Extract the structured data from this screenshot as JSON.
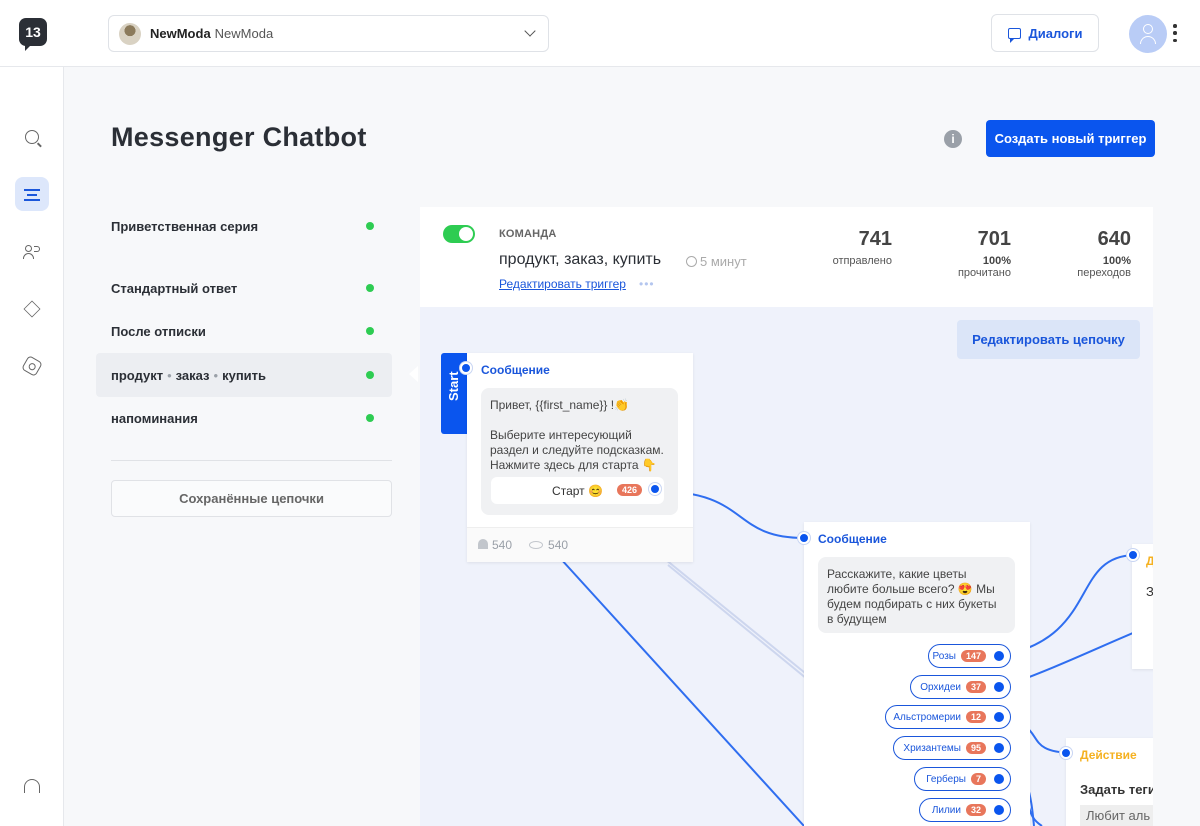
{
  "topbar": {
    "logo": "13",
    "account": {
      "name": "NewModa",
      "sub": "NewModa"
    },
    "dialogs_label": "Диалоги"
  },
  "rail": {
    "items": [
      {
        "icon": "search-icon"
      },
      {
        "icon": "flow-icon",
        "active": true
      },
      {
        "icon": "users-icon"
      },
      {
        "icon": "layers-icon"
      },
      {
        "icon": "settings-icon"
      },
      {
        "icon": "support-icon"
      }
    ]
  },
  "page": {
    "title": "Messenger Chatbot",
    "create_label": "Создать новый триггер"
  },
  "triggers": [
    {
      "label": "Приветственная серия"
    },
    {
      "label": "Стандартный ответ"
    },
    {
      "label": "После отписки"
    },
    {
      "parts": [
        "продукт",
        "заказ",
        "купить"
      ],
      "sep": "•",
      "active": true
    },
    {
      "label": "напоминания"
    }
  ],
  "saved_label": "Сохранённые цепочки",
  "trigger_header": {
    "type_label": "КОМАНДА",
    "keywords": "продукт, заказ, купить",
    "delay": "5 минут",
    "edit_label": "Редактировать триггер",
    "more": "•••",
    "stats": [
      {
        "value": "741",
        "pct": "",
        "label": "отправлено"
      },
      {
        "value": "701",
        "pct": "100%",
        "label": "прочитано"
      },
      {
        "value": "640",
        "pct": "100%",
        "label": "переходов"
      }
    ]
  },
  "canvas": {
    "edit_chain_label": "Редактировать цепочку",
    "start_label": "Start",
    "card1": {
      "title": "Сообщение",
      "line1": "Привет,  {{first_name}} !👏",
      "line2": "Выберите интересующий раздел и следуйте подсказкам. Нажмите здесь для старта 👇",
      "button_label": "Старт 😊",
      "button_count": "426",
      "users": "540",
      "views": "540"
    },
    "card2": {
      "title": "Сообщение",
      "text": "Расскажите, какие цветы любите больше всего? 😍 Мы будем подбирать с них букеты в будущем",
      "buttons": [
        {
          "label": "Розы",
          "count": "147"
        },
        {
          "label": "Орхидеи",
          "count": "37"
        },
        {
          "label": "Альстромерии",
          "count": "12"
        },
        {
          "label": "Хризантемы",
          "count": "95"
        },
        {
          "label": "Герберы",
          "count": "7"
        },
        {
          "label": "Лилии",
          "count": "32"
        }
      ]
    },
    "card3": {
      "title": "Д",
      "line": "З"
    },
    "card4": {
      "title": "Действие",
      "action": "Задать теги",
      "tag": "Любит аль"
    }
  }
}
